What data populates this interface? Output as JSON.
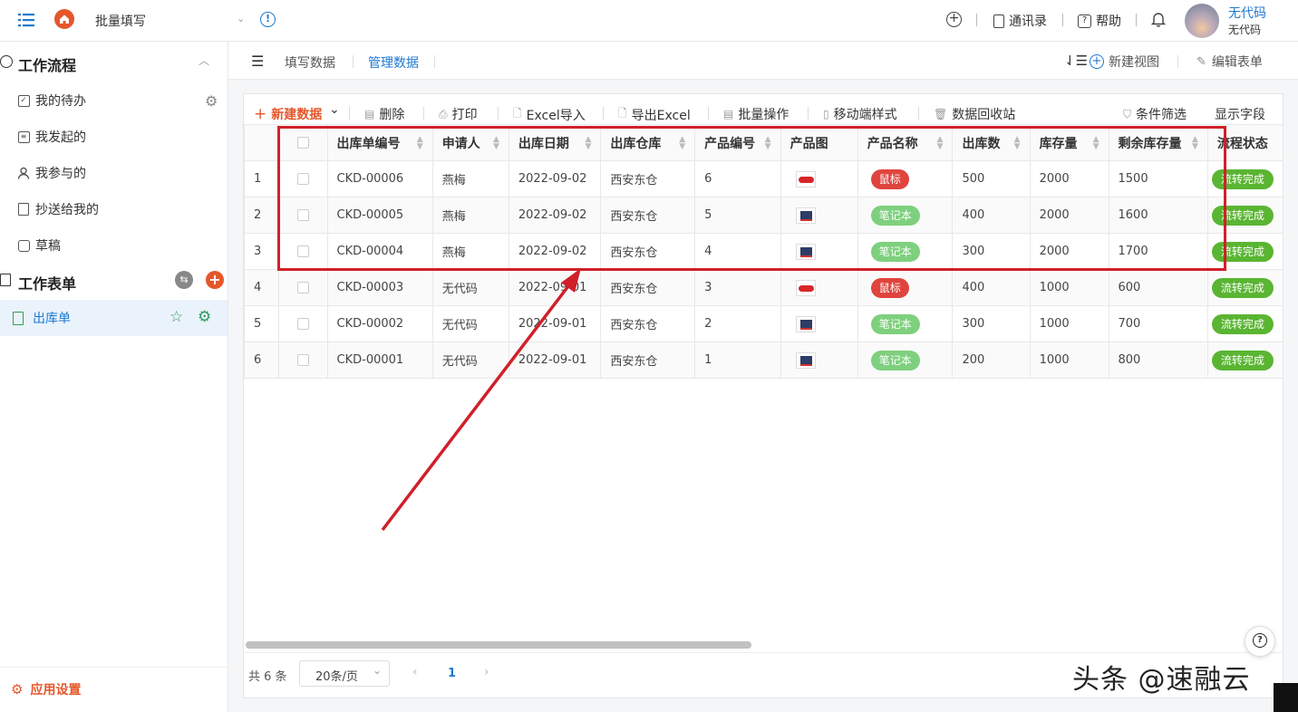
{
  "header": {
    "app_title": "批量填写",
    "contacts": "通讯录",
    "help": "帮助",
    "user_name": "无代码",
    "user_sub": "无代码"
  },
  "sidebar": {
    "workflow_title": "工作流程",
    "items": [
      {
        "label": "我的待办",
        "icon": "check-square-icon"
      },
      {
        "label": "我发起的",
        "icon": "list-icon"
      },
      {
        "label": "我参与的",
        "icon": "user-icon"
      },
      {
        "label": "抄送给我的",
        "icon": "document-icon"
      },
      {
        "label": "草稿",
        "icon": "draft-icon"
      }
    ],
    "forms_title": "工作表单",
    "active_form": "出库单",
    "app_settings": "应用设置"
  },
  "tabs": {
    "fill": "填写数据",
    "manage": "管理数据",
    "new_view": "新建视图",
    "edit_form": "编辑表单"
  },
  "toolbar": {
    "new_data": "新建数据",
    "delete": "删除",
    "print": "打印",
    "excel_import": "Excel导入",
    "export_excel": "导出Excel",
    "batch": "批量操作",
    "mobile_style": "移动端样式",
    "recycle": "数据回收站",
    "filter": "条件筛选",
    "show_fields": "显示字段"
  },
  "table": {
    "columns": [
      "出库单编号",
      "申请人",
      "出库日期",
      "出库仓库",
      "产品编号",
      "产品图",
      "产品名称",
      "出库数",
      "库存量",
      "剩余库存量",
      "流程状态"
    ],
    "rows": [
      {
        "idx": "1",
        "no": "CKD-00006",
        "applicant": "燕梅",
        "date": "2022-09-02",
        "warehouse": "西安东仓",
        "pid": "6",
        "img": "mouse",
        "pname": "鼠标",
        "out": "500",
        "stock": "2000",
        "remain": "1500",
        "status": "流转完成"
      },
      {
        "idx": "2",
        "no": "CKD-00005",
        "applicant": "燕梅",
        "date": "2022-09-02",
        "warehouse": "西安东仓",
        "pid": "5",
        "img": "laptop",
        "pname": "笔记本",
        "out": "400",
        "stock": "2000",
        "remain": "1600",
        "status": "流转完成"
      },
      {
        "idx": "3",
        "no": "CKD-00004",
        "applicant": "燕梅",
        "date": "2022-09-02",
        "warehouse": "西安东仓",
        "pid": "4",
        "img": "laptop",
        "pname": "笔记本",
        "out": "300",
        "stock": "2000",
        "remain": "1700",
        "status": "流转完成"
      },
      {
        "idx": "4",
        "no": "CKD-00003",
        "applicant": "无代码",
        "date": "2022-09-01",
        "warehouse": "西安东仓",
        "pid": "3",
        "img": "mouse",
        "pname": "鼠标",
        "out": "400",
        "stock": "1000",
        "remain": "600",
        "status": "流转完成"
      },
      {
        "idx": "5",
        "no": "CKD-00002",
        "applicant": "无代码",
        "date": "2022-09-01",
        "warehouse": "西安东仓",
        "pid": "2",
        "img": "laptop",
        "pname": "笔记本",
        "out": "300",
        "stock": "1000",
        "remain": "700",
        "status": "流转完成"
      },
      {
        "idx": "6",
        "no": "CKD-00001",
        "applicant": "无代码",
        "date": "2022-09-01",
        "warehouse": "西安东仓",
        "pid": "1",
        "img": "laptop",
        "pname": "笔记本",
        "out": "200",
        "stock": "1000",
        "remain": "800",
        "status": "流转完成"
      }
    ]
  },
  "footer": {
    "total": "共 6 条",
    "page_size": "20条/页",
    "page": "1"
  },
  "watermark": "头条 @速融云",
  "colors": {
    "accent": "#1f78d1",
    "orange": "#e5572b",
    "highlight": "#d0202a",
    "flow_green": "#5ab532"
  }
}
